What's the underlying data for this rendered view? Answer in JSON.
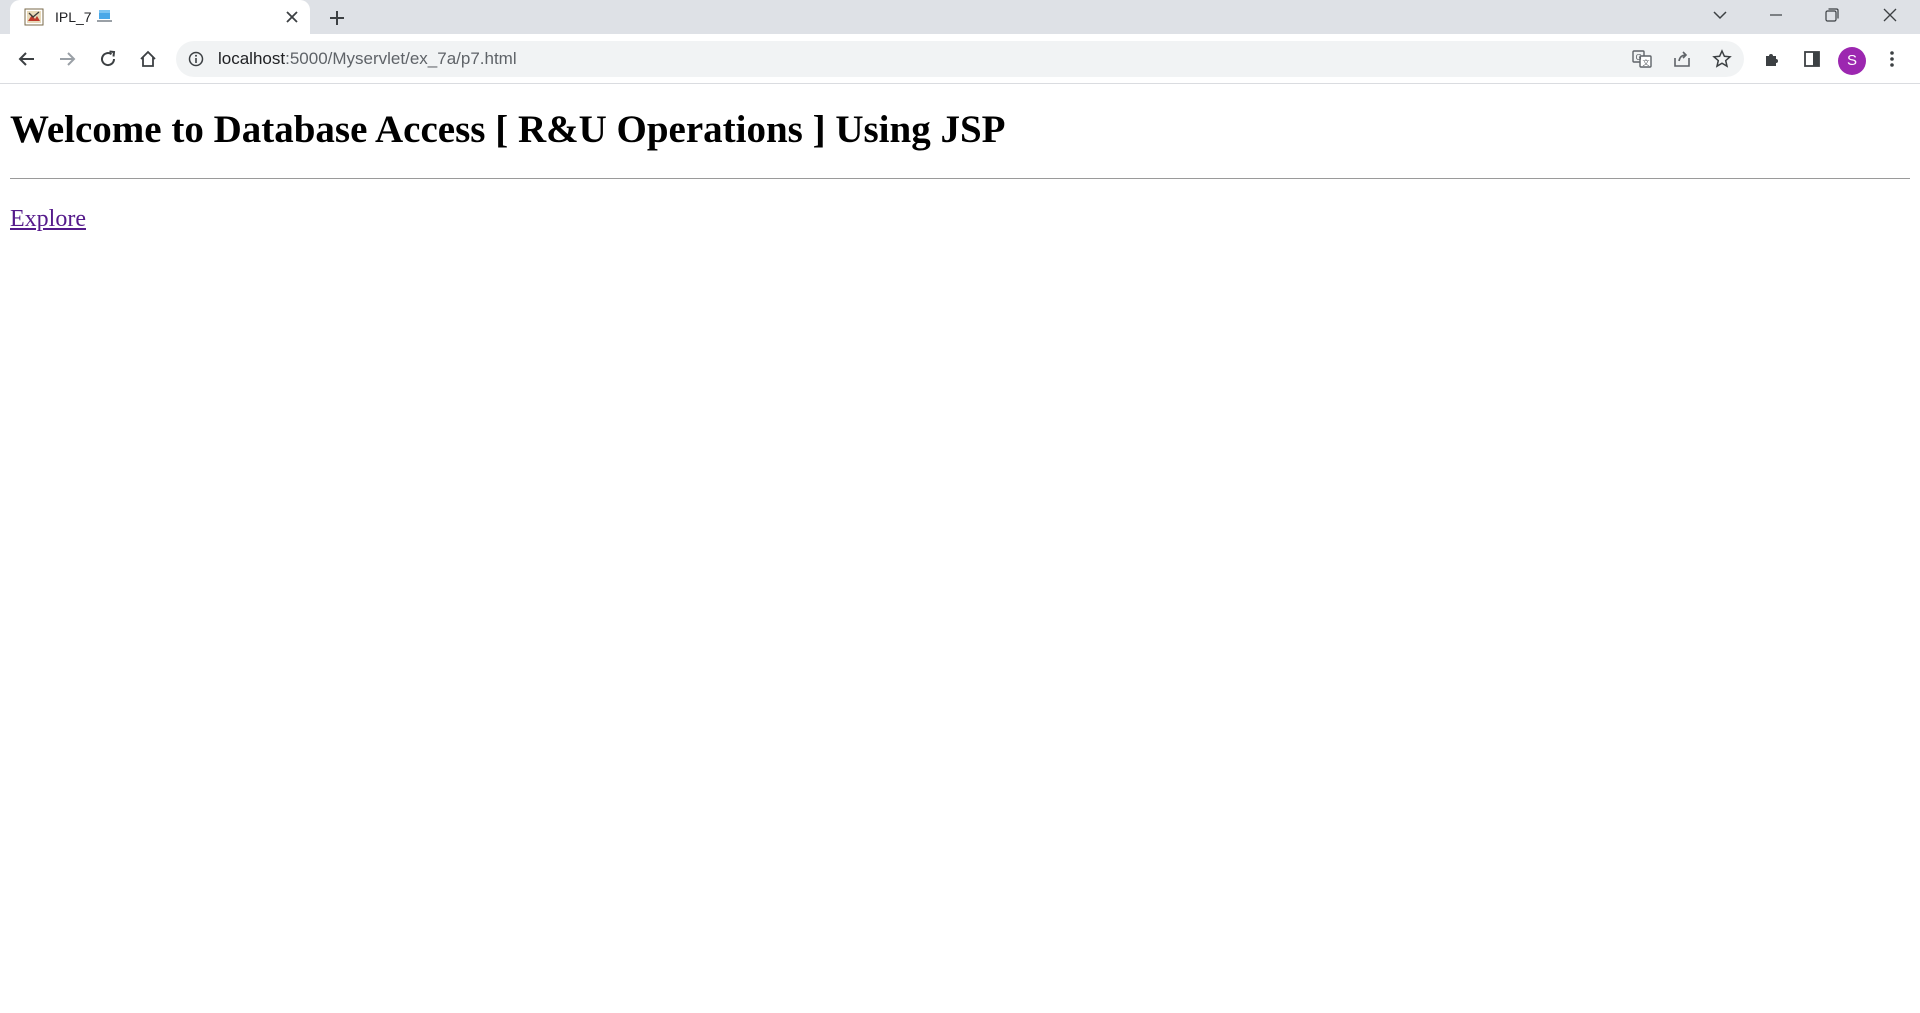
{
  "browser": {
    "tab": {
      "title": "IPL_7",
      "favicon": "java-coffee-icon",
      "badge": "laptop-icon"
    },
    "toolbar": {
      "url_host": "localhost",
      "url_path": ":5000/Myservlet/ex_7a/p7.html",
      "avatar_initial": "S",
      "avatar_color": "#9c27b0"
    }
  },
  "page": {
    "title": "Welcome to Database Access [ R&U Operations ] Using JSP",
    "link_label": "Explore",
    "link_color": "#551a8b"
  }
}
